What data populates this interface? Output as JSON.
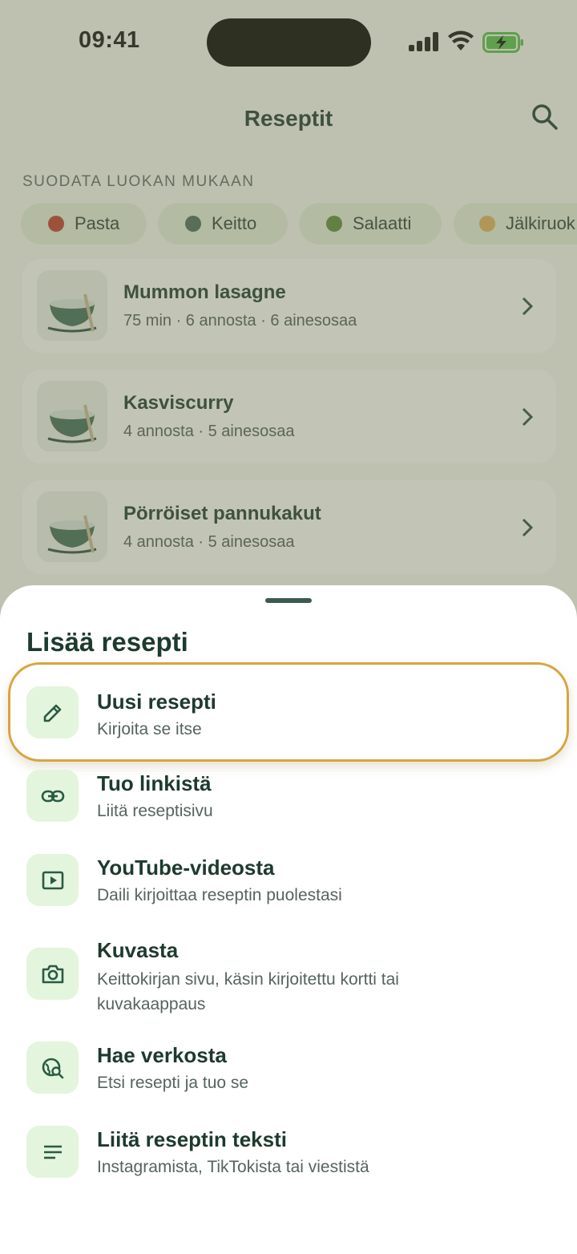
{
  "status_bar": {
    "time": "09:41"
  },
  "header": {
    "title": "Reseptit"
  },
  "filter": {
    "label": "SUODATA LUOKAN MUKAAN",
    "chips": [
      {
        "label": "Pasta",
        "icon": "tomato-icon",
        "color": "#c0392b"
      },
      {
        "label": "Keitto",
        "icon": "soup-bowl-icon",
        "color": "#4a6b5a"
      },
      {
        "label": "Salaatti",
        "icon": "salad-icon",
        "color": "#5b8a3a"
      },
      {
        "label": "Jälkiruok",
        "icon": "cake-icon",
        "color": "#e0b060"
      }
    ]
  },
  "recipes": [
    {
      "title": "Mummon lasagne",
      "meta": "75 min · 6 annosta · 6 ainesosaa"
    },
    {
      "title": "Kasviscurry",
      "meta": "4 annosta · 5 ainesosaa"
    },
    {
      "title": "Pörröiset pannukakut",
      "meta": "4 annosta · 5 ainesosaa"
    }
  ],
  "sheet": {
    "title": "Lisää resepti",
    "options": [
      {
        "title": "Uusi resepti",
        "subtitle": "Kirjoita se itse",
        "icon": "pencil-icon",
        "highlighted": true
      },
      {
        "title": "Tuo linkistä",
        "subtitle": "Liitä reseptisivu",
        "icon": "link-icon"
      },
      {
        "title": "YouTube-videosta",
        "subtitle": "Daili kirjoittaa reseptin puolestasi",
        "icon": "video-play-icon"
      },
      {
        "title": "Kuvasta",
        "subtitle": "Keittokirjan sivu, käsin kirjoitettu kortti tai kuvakaappaus",
        "icon": "camera-icon"
      },
      {
        "title": "Hae verkosta",
        "subtitle": "Etsi resepti ja tuo se",
        "icon": "web-search-icon"
      },
      {
        "title": "Liitä reseptin teksti",
        "subtitle": "Instagramista, TikTokista tai viestistä",
        "icon": "text-lines-icon"
      }
    ]
  },
  "colors": {
    "accent": "#1d3a2e",
    "chip_bg": "#e5f0dc",
    "icon_bg": "#e3f5dc",
    "highlight": "#d9a441"
  }
}
